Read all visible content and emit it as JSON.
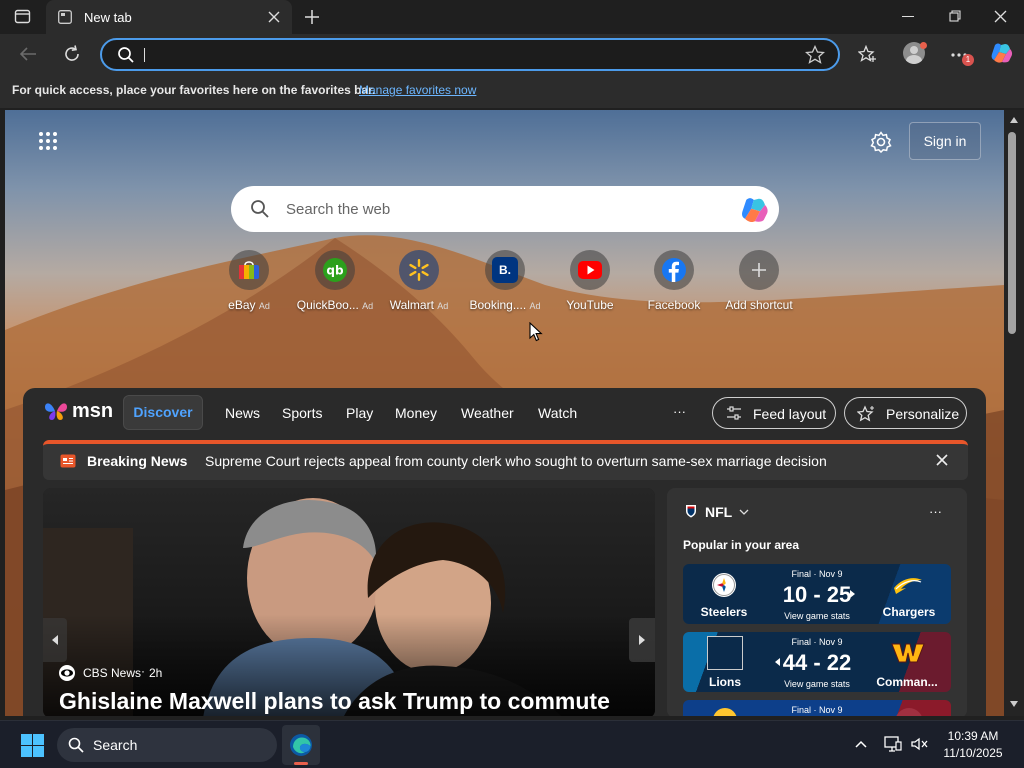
{
  "browser": {
    "tab_title": "New tab",
    "favbar_text": "For quick access, place your favorites here on the favorites bar.",
    "favbar_link": "Manage favorites now",
    "profile_badge": "1"
  },
  "ntp": {
    "sign_in": "Sign in",
    "search_placeholder": "Search the web",
    "shortcuts": [
      {
        "label": "eBay",
        "ad": "Ad"
      },
      {
        "label": "QuickBoo...",
        "ad": "Ad"
      },
      {
        "label": "Walmart",
        "ad": "Ad"
      },
      {
        "label": "Booking....",
        "ad": "Ad"
      },
      {
        "label": "YouTube",
        "ad": ""
      },
      {
        "label": "Facebook",
        "ad": ""
      },
      {
        "label": "Add shortcut",
        "ad": ""
      }
    ],
    "booking_icon_text": "B."
  },
  "msn": {
    "brand": "msn",
    "nav": [
      "Discover",
      "News",
      "Sports",
      "Play",
      "Money",
      "Weather",
      "Watch"
    ],
    "more": "···",
    "feed_layout": "Feed layout",
    "personalize": "Personalize",
    "breaking_label": "Breaking News",
    "breaking_text": "Supreme Court rejects appeal from county clerk who sought to overturn same-sex marriage decision",
    "hero": {
      "source": "CBS News",
      "age": "2h",
      "headline": "Ghislaine Maxwell plans to ask Trump to commute"
    },
    "nfl": {
      "title": "NFL",
      "subtitle": "Popular in your area",
      "more": "···",
      "games": [
        {
          "status": "Final · Nov 9",
          "home": "Steelers",
          "away": "Chargers",
          "score": "10 - 25",
          "link": "View game stats",
          "colors": [
            "#0b2a4a",
            "#0b3b6e"
          ]
        },
        {
          "status": "Final · Nov 9",
          "home": "Lions",
          "away": "Comman...",
          "score": "44 - 22",
          "link": "View game stats",
          "colors": [
            "#0a6ea8",
            "#6b1b2e"
          ]
        },
        {
          "status": "Final · Nov 9",
          "home": "",
          "away": "",
          "score": "",
          "link": "",
          "colors": [
            "#0d3f8a",
            "#8b1a2a"
          ]
        }
      ]
    }
  },
  "taskbar": {
    "search": "Search",
    "time": "10:39 AM",
    "date": "11/10/2025"
  }
}
